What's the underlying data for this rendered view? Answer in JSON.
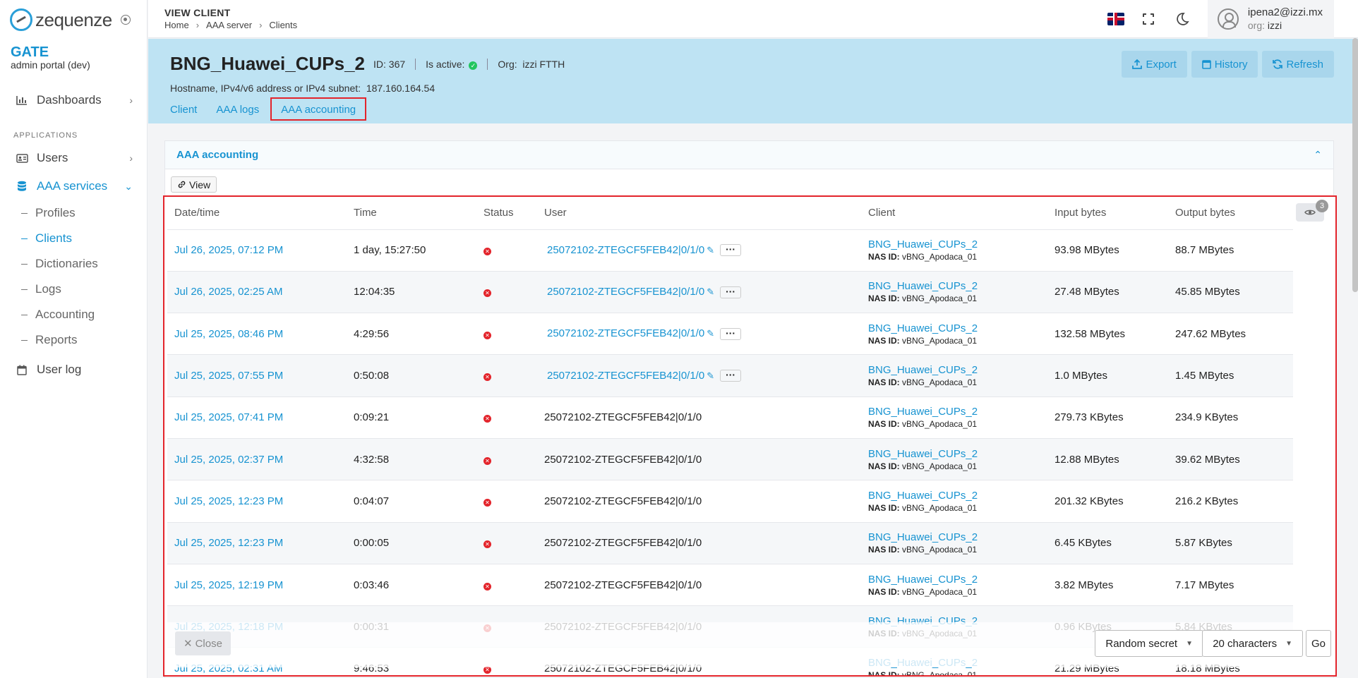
{
  "sidebar": {
    "logo_text": "zequenze",
    "brand_name": "GATE",
    "brand_sub": "admin portal (dev)",
    "section_label": "APPLICATIONS",
    "items": {
      "dashboards": "Dashboards",
      "users": "Users",
      "aaa_services": "AAA services",
      "user_log": "User log"
    },
    "sub_items": [
      "Profiles",
      "Clients",
      "Dictionaries",
      "Logs",
      "Accounting",
      "Reports"
    ]
  },
  "topbar": {
    "title": "VIEW CLIENT",
    "breadcrumb": [
      "Home",
      "AAA server",
      "Clients"
    ],
    "user_email": "ipena2@izzi.mx",
    "org_label": "org:",
    "org_value": "izzi"
  },
  "client": {
    "name": "BNG_Huawei_CUPs_2",
    "id_label": "ID:",
    "id_value": "367",
    "active_label": "Is active:",
    "org_label": "Org:",
    "org_value": "izzi FTTH",
    "host_label": "Hostname, IPv4/v6 address or IPv4 subnet:",
    "host_value": "187.160.164.54",
    "actions": {
      "export": "Export",
      "history": "History",
      "refresh": "Refresh"
    },
    "tabs": [
      "Client",
      "AAA logs",
      "AAA accounting"
    ]
  },
  "panel": {
    "title": "AAA accounting",
    "view_label": "View",
    "columns_badge": "3",
    "columns": [
      "Date/time",
      "Time",
      "Status",
      "User",
      "Client",
      "Input bytes",
      "Output bytes"
    ],
    "nas_label": "NAS ID:",
    "rows": [
      {
        "dt": "Jul 26, 2025, 07:12 PM",
        "time": "1 day, 15:27:50",
        "user": "25072102-ZTEGCF5FEB42|0/1/0",
        "client": "BNG_Huawei_CUPs_2",
        "nas": "vBNG_Apodaca_01",
        "in": "93.98 MBytes",
        "out": "88.7 MBytes"
      },
      {
        "dt": "Jul 26, 2025, 02:25 AM",
        "time": "12:04:35",
        "user": "25072102-ZTEGCF5FEB42|0/1/0",
        "client": "BNG_Huawei_CUPs_2",
        "nas": "vBNG_Apodaca_01",
        "in": "27.48 MBytes",
        "out": "45.85 MBytes"
      },
      {
        "dt": "Jul 25, 2025, 08:46 PM",
        "time": "4:29:56",
        "user": "25072102-ZTEGCF5FEB42|0/1/0",
        "client": "BNG_Huawei_CUPs_2",
        "nas": "vBNG_Apodaca_01",
        "in": "132.58 MBytes",
        "out": "247.62 MBytes"
      },
      {
        "dt": "Jul 25, 2025, 07:55 PM",
        "time": "0:50:08",
        "user": "25072102-ZTEGCF5FEB42|0/1/0",
        "client": "BNG_Huawei_CUPs_2",
        "nas": "vBNG_Apodaca_01",
        "in": "1.0 MBytes",
        "out": "1.45 MBytes"
      },
      {
        "dt": "Jul 25, 2025, 07:41 PM",
        "time": "0:09:21",
        "user": "25072102-ZTEGCF5FEB42|0/1/0",
        "client": "BNG_Huawei_CUPs_2",
        "nas": "vBNG_Apodaca_01",
        "in": "279.73 KBytes",
        "out": "234.9 KBytes"
      },
      {
        "dt": "Jul 25, 2025, 02:37 PM",
        "time": "4:32:58",
        "user": "25072102-ZTEGCF5FEB42|0/1/0",
        "client": "BNG_Huawei_CUPs_2",
        "nas": "vBNG_Apodaca_01",
        "in": "12.88 MBytes",
        "out": "39.62 MBytes"
      },
      {
        "dt": "Jul 25, 2025, 12:23 PM",
        "time": "0:04:07",
        "user": "25072102-ZTEGCF5FEB42|0/1/0",
        "client": "BNG_Huawei_CUPs_2",
        "nas": "vBNG_Apodaca_01",
        "in": "201.32 KBytes",
        "out": "216.2 KBytes"
      },
      {
        "dt": "Jul 25, 2025, 12:23 PM",
        "time": "0:00:05",
        "user": "25072102-ZTEGCF5FEB42|0/1/0",
        "client": "BNG_Huawei_CUPs_2",
        "nas": "vBNG_Apodaca_01",
        "in": "6.45 KBytes",
        "out": "5.87 KBytes"
      },
      {
        "dt": "Jul 25, 2025, 12:19 PM",
        "time": "0:03:46",
        "user": "25072102-ZTEGCF5FEB42|0/1/0",
        "client": "BNG_Huawei_CUPs_2",
        "nas": "vBNG_Apodaca_01",
        "in": "3.82 MBytes",
        "out": "7.17 MBytes"
      },
      {
        "dt": "Jul 25, 2025, 12:18 PM",
        "time": "0:00:31",
        "user": "25072102-ZTEGCF5FEB42|0/1/0",
        "client": "BNG_Huawei_CUPs_2",
        "nas": "vBNG_Apodaca_01",
        "in": "0.96 KBytes",
        "out": "5.84 KBytes"
      },
      {
        "dt": "Jul 25, 2025, 02:31 AM",
        "time": "9:46:53",
        "user": "25072102-ZTEGCF5FEB42|0/1/0",
        "client": "BNG_Huawei_CUPs_2",
        "nas": "vBNG_Apodaca_01",
        "in": "21.29 MBytes",
        "out": "18.18 MBytes"
      }
    ]
  },
  "footer": {
    "close_label": "Close",
    "secret_select": "Random secret",
    "length_select": "20 characters",
    "go_label": "Go"
  },
  "icons": {
    "pin": "pin-icon",
    "dashboards": "chart-icon",
    "users": "id-card-icon",
    "aaa": "database-icon",
    "user_log": "calendar-icon",
    "flag": "uk-flag-icon",
    "fullscreen": "fullscreen-icon",
    "theme": "moon-icon",
    "avatar": "user-circle-icon",
    "status": "error-circle-icon",
    "columns": "eye-icon"
  },
  "colors": {
    "accent": "#1793d1",
    "header_bg": "#bee3f3",
    "highlight": "#e3242b",
    "active_ok": "#22c55e"
  }
}
